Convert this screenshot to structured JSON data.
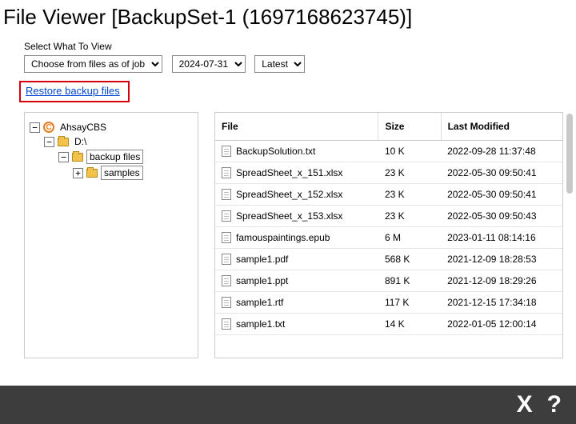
{
  "title": "File Viewer [BackupSet-1 (1697168623745)]",
  "controls": {
    "label": "Select What To View",
    "job_select": "Choose from files as of job",
    "date_select": "2024-07-31",
    "version_select": "Latest"
  },
  "restore_link": "Restore backup files",
  "tree": {
    "root": {
      "label": "AhsayCBS",
      "icon": "ahsay-logo",
      "toggle": "−"
    },
    "drive": {
      "label": "D:\\",
      "toggle": "−"
    },
    "folder1": {
      "label": "backup files",
      "toggle": "−"
    },
    "folder2": {
      "label": "samples",
      "toggle": "+"
    }
  },
  "table": {
    "headers": {
      "file": "File",
      "size": "Size",
      "modified": "Last Modified"
    },
    "rows": [
      {
        "name": "BackupSolution.txt",
        "size": "10 K",
        "modified": "2022-09-28 11:37:48"
      },
      {
        "name": "SpreadSheet_x_151.xlsx",
        "size": "23 K",
        "modified": "2022-05-30 09:50:41"
      },
      {
        "name": "SpreadSheet_x_152.xlsx",
        "size": "23 K",
        "modified": "2022-05-30 09:50:41"
      },
      {
        "name": "SpreadSheet_x_153.xlsx",
        "size": "23 K",
        "modified": "2022-05-30 09:50:43"
      },
      {
        "name": "famouspaintings.epub",
        "size": "6 M",
        "modified": "2023-01-11 08:14:16"
      },
      {
        "name": "sample1.pdf",
        "size": "568 K",
        "modified": "2021-12-09 18:28:53"
      },
      {
        "name": "sample1.ppt",
        "size": "891 K",
        "modified": "2021-12-09 18:29:26"
      },
      {
        "name": "sample1.rtf",
        "size": "117 K",
        "modified": "2021-12-15 17:34:18"
      },
      {
        "name": "sample1.txt",
        "size": "14 K",
        "modified": "2022-01-05 12:00:14"
      }
    ]
  },
  "footer": {
    "close": "X",
    "help": "?"
  }
}
